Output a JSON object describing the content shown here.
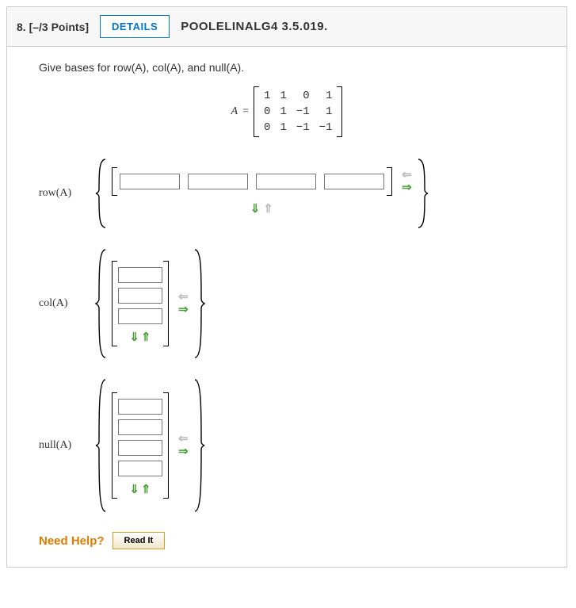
{
  "header": {
    "number": "8.",
    "points": "[–/3 Points]",
    "details": "DETAILS",
    "ref": "POOLELINALG4 3.5.019."
  },
  "prompt": "Give bases for row(A), col(A), and null(A).",
  "matrix": {
    "label": "A",
    "eq": "=",
    "rows": [
      [
        "1",
        "1",
        "0",
        "1"
      ],
      [
        "0",
        "1",
        "−1",
        "1"
      ],
      [
        "0",
        "1",
        "−1",
        "−1"
      ]
    ]
  },
  "sections": {
    "row": {
      "label": "row(A)"
    },
    "col": {
      "label": "col(A)"
    },
    "null": {
      "label": "null(A)"
    }
  },
  "needhelp": {
    "label": "Need Help?",
    "readit": "Read It"
  }
}
